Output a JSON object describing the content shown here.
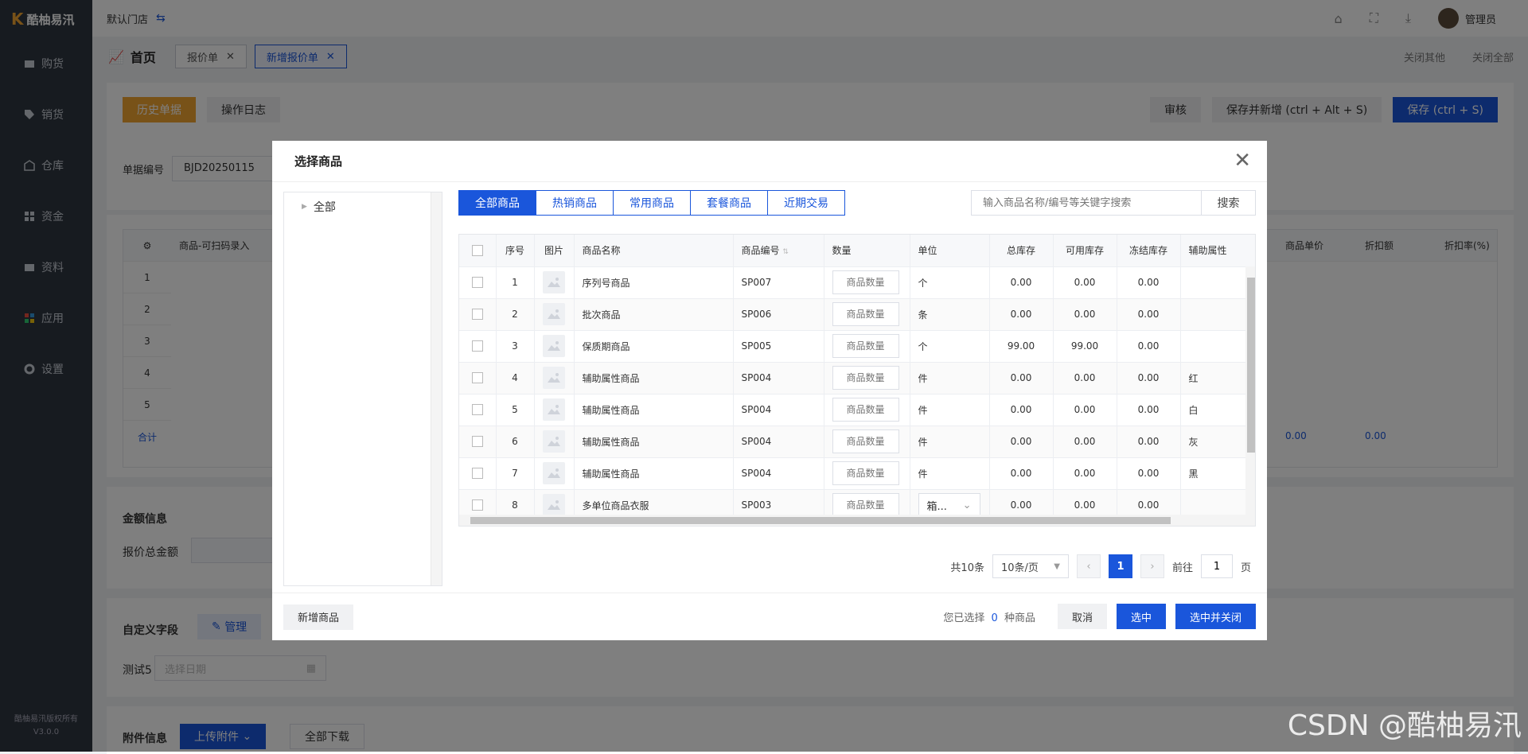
{
  "app": {
    "brand": "酷柚易汛",
    "store": "默认门店",
    "user": "管理员",
    "footer_line1": "酷柚易汛版权所有",
    "footer_line2": "V3.0.0"
  },
  "sidebar": {
    "items": [
      {
        "label": "购货",
        "icon": "cart-icon"
      },
      {
        "label": "销货",
        "icon": "tag-icon"
      },
      {
        "label": "仓库",
        "icon": "warehouse-icon"
      },
      {
        "label": "资金",
        "icon": "grid-icon"
      },
      {
        "label": "资料",
        "icon": "folder-icon"
      },
      {
        "label": "应用",
        "icon": "apps-icon"
      },
      {
        "label": "设置",
        "icon": "gear-icon"
      }
    ]
  },
  "tabs": {
    "home": "首页",
    "items": [
      {
        "label": "报价单"
      },
      {
        "label": "新增报价单"
      }
    ],
    "close_others": "关闭其他",
    "close_all": "关闭全部"
  },
  "page": {
    "history_btn": "历史单据",
    "log_btn": "操作日志",
    "audit_btn": "审核",
    "save_new_btn": "保存并新增 (ctrl + Alt + S)",
    "save_btn": "保存 (ctrl + S)",
    "doc_no_label": "单据编号",
    "doc_no_value": "BJD20250115",
    "col_product": "商品-可扫码录入",
    "col_unit_price": "商品单价",
    "col_discount": "折扣额",
    "col_discount_rate": "折扣率(%)",
    "rows": [
      "1",
      "2",
      "3",
      "4",
      "5"
    ],
    "total_label": "合计",
    "total_price": "0.00",
    "total_discount": "0.00",
    "amount_section": "金额信息",
    "amount_total_label": "报价总金额",
    "custom_section": "自定义字段",
    "manage_btn": "管理",
    "test_label": "测试5",
    "date_placeholder": "选择日期",
    "attach_section": "附件信息",
    "upload_btn": "上传附件",
    "download_all": "全部下载"
  },
  "modal": {
    "title": "选择商品",
    "tree": {
      "root": "全部"
    },
    "segments": [
      "全部商品",
      "热销商品",
      "常用商品",
      "套餐商品",
      "近期交易"
    ],
    "search": {
      "placeholder": "输入商品名称/编号等关键字搜索",
      "button": "搜索"
    },
    "columns": [
      "序号",
      "图片",
      "商品名称",
      "商品编号",
      "数量",
      "单位",
      "总库存",
      "可用库存",
      "冻结库存",
      "辅助属性"
    ],
    "qty_placeholder": "商品数量",
    "rows": [
      {
        "no": "1",
        "name": "序列号商品",
        "code": "SP007",
        "unit": "个",
        "total": "0.00",
        "avail": "0.00",
        "frozen": "0.00",
        "attr": ""
      },
      {
        "no": "2",
        "name": "批次商品",
        "code": "SP006",
        "unit": "条",
        "total": "0.00",
        "avail": "0.00",
        "frozen": "0.00",
        "attr": ""
      },
      {
        "no": "3",
        "name": "保质期商品",
        "code": "SP005",
        "unit": "个",
        "total": "99.00",
        "avail": "99.00",
        "frozen": "0.00",
        "attr": ""
      },
      {
        "no": "4",
        "name": "辅助属性商品",
        "code": "SP004",
        "unit": "件",
        "total": "0.00",
        "avail": "0.00",
        "frozen": "0.00",
        "attr": "红"
      },
      {
        "no": "5",
        "name": "辅助属性商品",
        "code": "SP004",
        "unit": "件",
        "total": "0.00",
        "avail": "0.00",
        "frozen": "0.00",
        "attr": "白"
      },
      {
        "no": "6",
        "name": "辅助属性商品",
        "code": "SP004",
        "unit": "件",
        "total": "0.00",
        "avail": "0.00",
        "frozen": "0.00",
        "attr": "灰"
      },
      {
        "no": "7",
        "name": "辅助属性商品",
        "code": "SP004",
        "unit": "件",
        "total": "0.00",
        "avail": "0.00",
        "frozen": "0.00",
        "attr": "黑"
      },
      {
        "no": "8",
        "name": "多单位商品衣服",
        "code": "SP003",
        "unit": "箱...",
        "total": "0.00",
        "avail": "0.00",
        "frozen": "0.00",
        "attr": ""
      }
    ],
    "pager": {
      "total": "共10条",
      "size": "10条/页",
      "current": "1",
      "goto": "前往",
      "goto_value": "1",
      "page_suffix": "页"
    },
    "footer": {
      "new_product": "新增商品",
      "selected_prefix": "您已选择",
      "selected_count": "0",
      "selected_suffix": "种商品",
      "cancel": "取消",
      "select": "选中",
      "select_close": "选中并关闭"
    }
  },
  "watermark": "CSDN @酷柚易汛",
  "colors": {
    "primary": "#1a56db",
    "orange": "#f0a431",
    "sidebar": "#2f3640"
  }
}
